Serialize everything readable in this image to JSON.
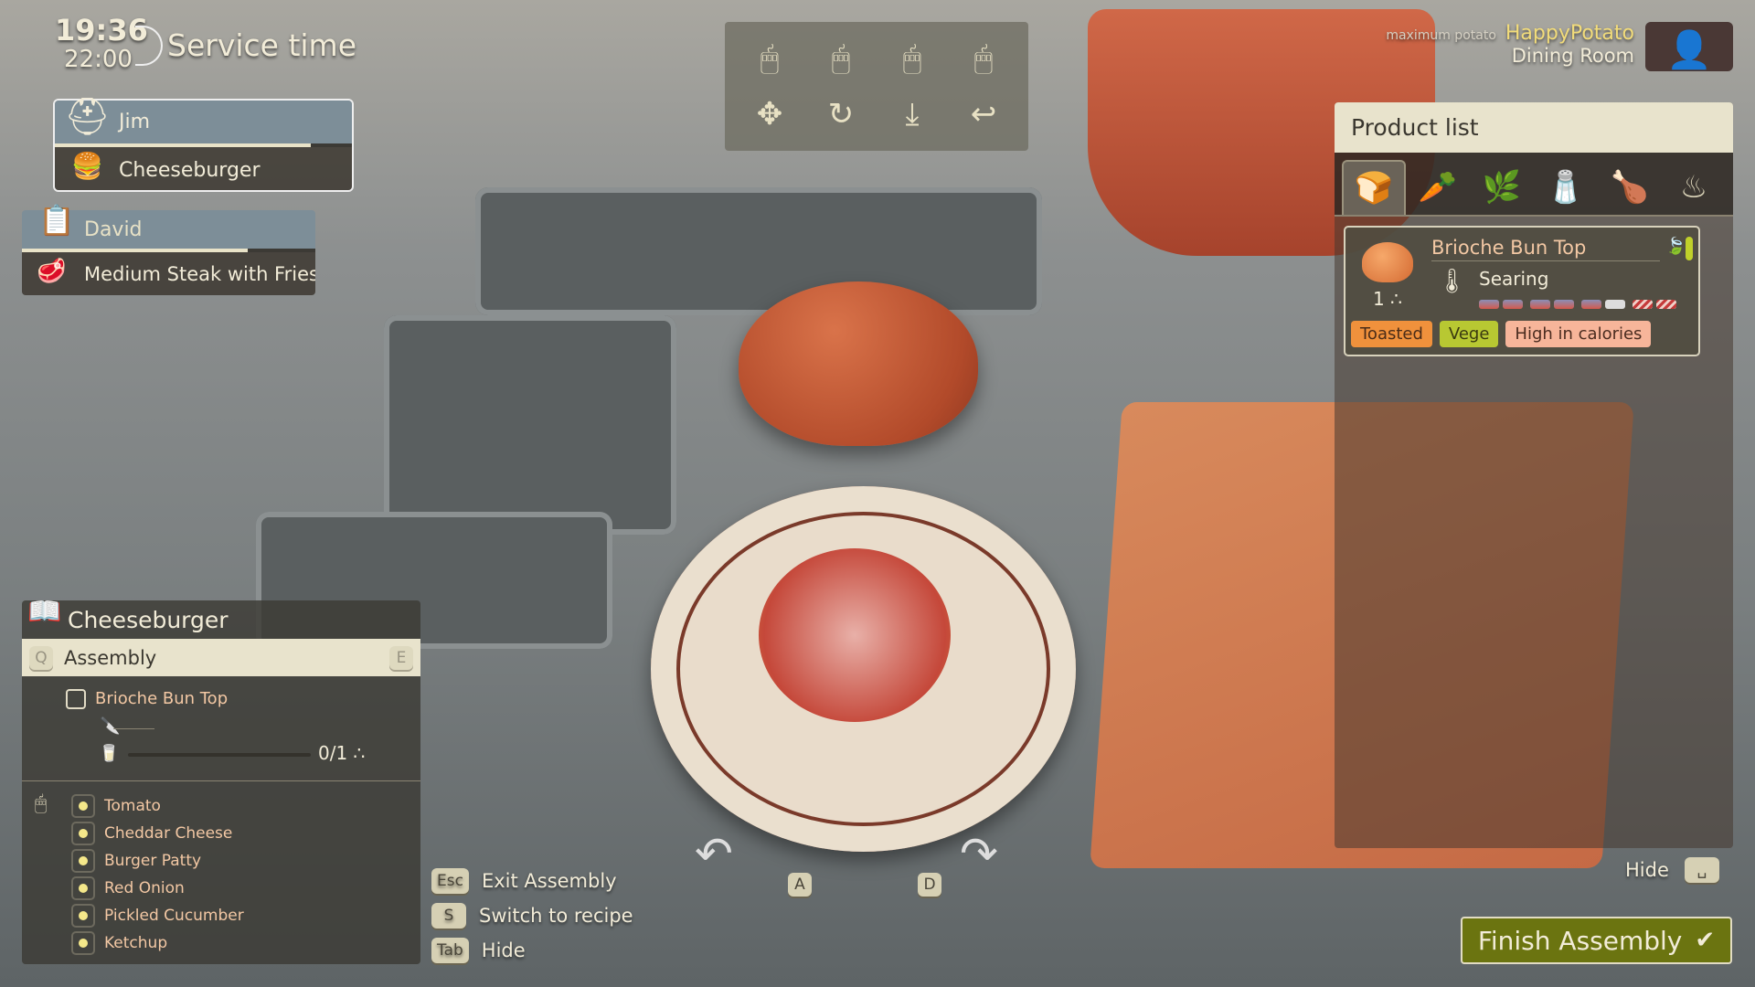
{
  "clock": {
    "current_time": "19:36",
    "end_time": "22:00",
    "label": "Service time"
  },
  "orders": [
    {
      "worker": "Jim",
      "dish": "Cheeseburger",
      "worker_icon": "hard-hat-icon",
      "dish_icon": "burger-icon",
      "progress": 0.86
    },
    {
      "worker": "David",
      "dish": "Medium Steak with Fries",
      "worker_icon": "clipboard-icon",
      "dish_icon": "steak-icon",
      "progress": 0.77
    }
  ],
  "controls": {
    "mouse_icons": [
      "mouse-move-icon",
      "mouse-scroll-rotate-icon",
      "mouse-left-click-icon",
      "mouse-right-click-icon"
    ],
    "action_icons": [
      "move-icon",
      "rotate-icon",
      "place-down-icon",
      "undo-icon"
    ]
  },
  "user": {
    "tagline": "maximum potato",
    "name": "HappyPotato",
    "location": "Dining Room"
  },
  "product_list": {
    "title": "Product list",
    "tabs": [
      "bread-icon",
      "vegetables-icon",
      "herbs-icon",
      "condiments-icon",
      "meat-icon",
      "cooking-pot-icon"
    ],
    "active_tab": 0,
    "item": {
      "name": "Brioche Bun Top",
      "quantity": "1",
      "process": "Searing",
      "tags": [
        {
          "label": "Toasted",
          "color": "#f0913c"
        },
        {
          "label": "Vege",
          "color": "#b8c832"
        },
        {
          "label": "High in calories",
          "color": "#f7b59a"
        }
      ]
    }
  },
  "recipe": {
    "title": "Cheeseburger",
    "stage": "Assembly",
    "prev_key": "Q",
    "next_key": "E",
    "current_step": {
      "name": "Brioche Bun Top",
      "count": "0/1",
      "checked": false
    },
    "ingredients": [
      "Tomato",
      "Cheddar Cheese",
      "Burger Patty",
      "Red Onion",
      "Pickled Cucumber",
      "Ketchup"
    ]
  },
  "hints": [
    {
      "key": "Esc",
      "label": "Exit Assembly"
    },
    {
      "key": "S",
      "label": "Switch to recipe"
    },
    {
      "key": "Tab",
      "label": "Hide"
    }
  ],
  "rotate_keys": {
    "left": "A",
    "right": "D"
  },
  "hide_hint": {
    "label": "Hide",
    "key": "␣"
  },
  "finish": {
    "label": "Finish Assembly",
    "icon": "checkmark-icon",
    "color": "#6b7410"
  }
}
